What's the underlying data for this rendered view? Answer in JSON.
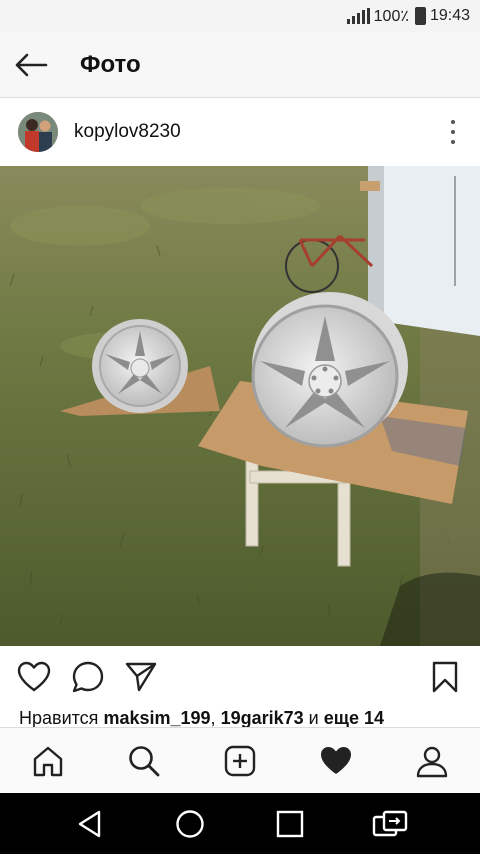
{
  "status_bar": {
    "battery": "100٪",
    "time": "19:43"
  },
  "app_bar": {
    "title": "Фото",
    "back_icon": "arrow-left-icon"
  },
  "post": {
    "username": "kopylov8230",
    "avatar_icon": "avatar-photo",
    "more_icon": "more-vertical-icon"
  },
  "actions": {
    "like_icon": "heart-outline-icon",
    "comment_icon": "comment-bubble-icon",
    "share_icon": "paper-plane-icon",
    "save_icon": "bookmark-icon"
  },
  "likes": {
    "prefix": "Нравится",
    "user1": "maksim_199",
    "separator": ",",
    "user2": "19garik73",
    "conjunction": "и",
    "more": "еще 14"
  },
  "tab_bar": {
    "items": [
      "home-icon",
      "search-icon",
      "add-post-icon",
      "activity-heart-icon",
      "profile-icon"
    ]
  },
  "nav_bar": {
    "items": [
      "back-triangle-icon",
      "home-circle-icon",
      "recents-square-icon",
      "switch-apps-icon"
    ]
  }
}
